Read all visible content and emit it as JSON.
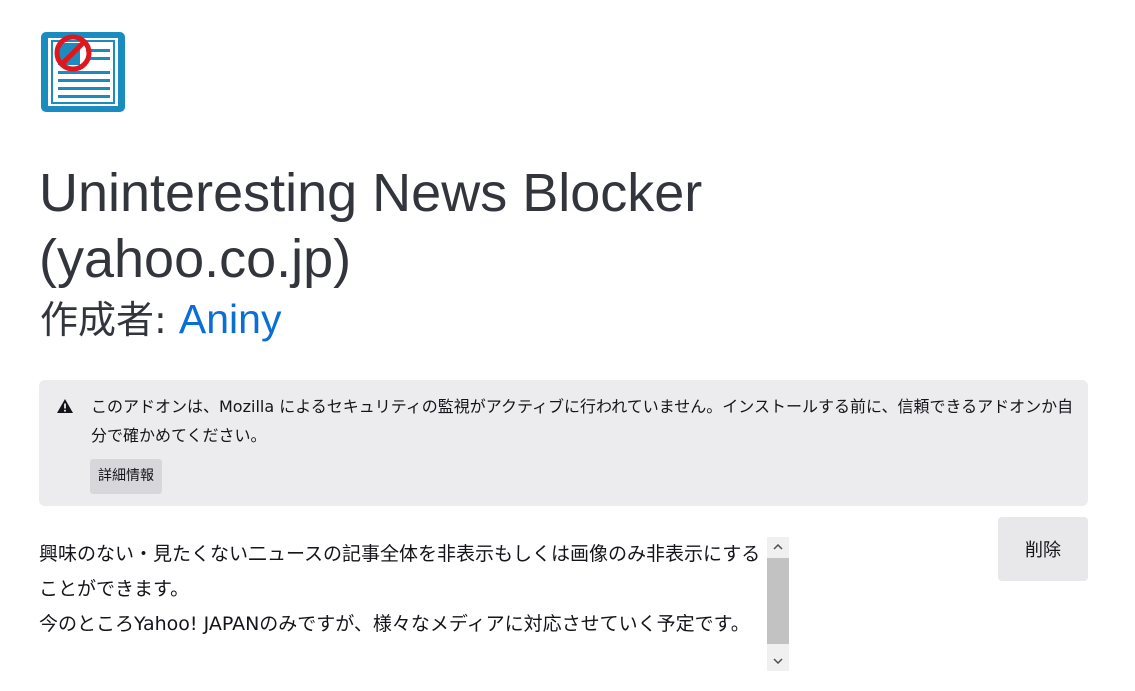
{
  "addon": {
    "icon": "addon-newspaper-blocked-icon",
    "title": "Uninteresting News Blocker (yahoo.co.jp)",
    "author_prefix": "作成者: ",
    "author_name": "Aniny"
  },
  "notice": {
    "icon": "warning-icon",
    "text": "このアドオンは、Mozilla によるセキュリティの監視がアクティブに行われていません。インストールする前に、信頼できるアドオンか自分で確かめてください。",
    "more_info_label": "詳細情報"
  },
  "actions": {
    "remove_label": "削除"
  },
  "description": {
    "paragraph1": "興味のない・見たくない二ュースの記事全体を非表示もしくは画像のみ非表示にすることができます。",
    "paragraph2": "今のところYahoo! JAPANのみですが、様々なメディアに対応させていく予定です。"
  },
  "colors": {
    "link": "#0a6fd4",
    "notice_bg": "#ececee",
    "icon_blue": "#1b8cbf",
    "prohibit_red": "#e0161d"
  }
}
